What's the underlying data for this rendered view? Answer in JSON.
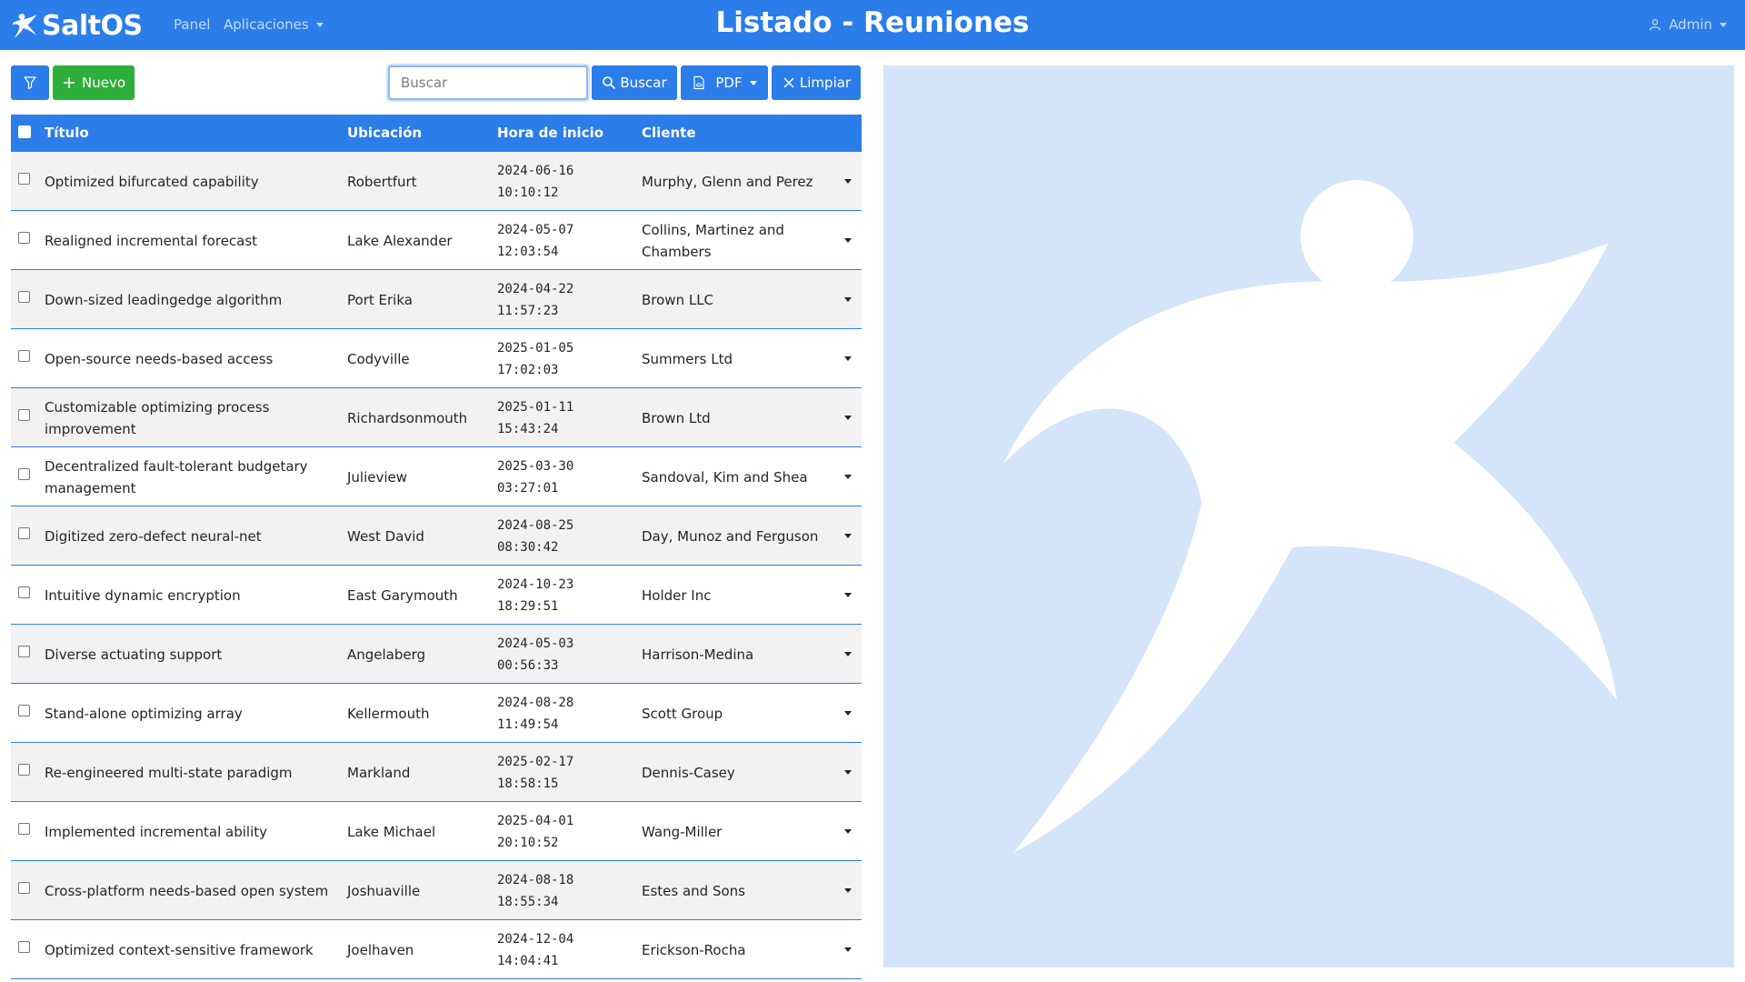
{
  "app": {
    "brand": "SaltOS"
  },
  "navbar": {
    "panel": "Panel",
    "apps": "Aplicaciones",
    "title": "Listado - Reuniones",
    "user": "Admin"
  },
  "toolbar": {
    "new_label": "Nuevo",
    "search_placeholder": "Buscar",
    "search_value": "",
    "search_label": "Buscar",
    "pdf_label": "PDF",
    "clear_label": "Limpiar"
  },
  "table": {
    "headers": [
      "Título",
      "Ubicación",
      "Hora de inicio",
      "Cliente"
    ],
    "rows": [
      {
        "title": "Optimized bifurcated capability",
        "location": "Robertfurt",
        "date": "2024-06-16",
        "time": "10:10:12",
        "client": "Murphy, Glenn and Perez"
      },
      {
        "title": "Realigned incremental forecast",
        "location": "Lake Alexander",
        "date": "2024-05-07",
        "time": "12:03:54",
        "client": "Collins, Martinez and Chambers"
      },
      {
        "title": "Down-sized leadingedge algorithm",
        "location": "Port Erika",
        "date": "2024-04-22",
        "time": "11:57:23",
        "client": "Brown LLC"
      },
      {
        "title": "Open-source needs-based access",
        "location": "Codyville",
        "date": "2025-01-05",
        "time": "17:02:03",
        "client": "Summers Ltd"
      },
      {
        "title": "Customizable optimizing process improvement",
        "location": "Richardsonmouth",
        "date": "2025-01-11",
        "time": "15:43:24",
        "client": "Brown Ltd"
      },
      {
        "title": "Decentralized fault-tolerant budgetary management",
        "location": "Julieview",
        "date": "2025-03-30",
        "time": "03:27:01",
        "client": "Sandoval, Kim and Shea"
      },
      {
        "title": "Digitized zero-defect neural-net",
        "location": "West David",
        "date": "2024-08-25",
        "time": "08:30:42",
        "client": "Day, Munoz and Ferguson"
      },
      {
        "title": "Intuitive dynamic encryption",
        "location": "East Garymouth",
        "date": "2024-10-23",
        "time": "18:29:51",
        "client": "Holder Inc"
      },
      {
        "title": "Diverse actuating support",
        "location": "Angelaberg",
        "date": "2024-05-03",
        "time": "00:56:33",
        "client": "Harrison-Medina"
      },
      {
        "title": "Stand-alone optimizing array",
        "location": "Kellermouth",
        "date": "2024-08-28",
        "time": "11:49:54",
        "client": "Scott Group"
      },
      {
        "title": "Re-engineered multi-state paradigm",
        "location": "Markland",
        "date": "2025-02-17",
        "time": "18:58:15",
        "client": "Dennis-Casey"
      },
      {
        "title": "Implemented incremental ability",
        "location": "Lake Michael",
        "date": "2025-04-01",
        "time": "20:10:52",
        "client": "Wang-Miller"
      },
      {
        "title": "Cross-platform needs-based open system",
        "location": "Joshuaville",
        "date": "2024-08-18",
        "time": "18:55:34",
        "client": "Estes and Sons"
      },
      {
        "title": "Optimized context-sensitive framework",
        "location": "Joelhaven",
        "date": "2024-12-04",
        "time": "14:04:41",
        "client": "Erickson-Rocha"
      }
    ]
  },
  "icons": {
    "brand": "saltos-star-icon",
    "user": "user-icon",
    "filter": "funnel-icon",
    "new": "plus-icon",
    "search": "search-icon",
    "pdf": "file-pdf-icon",
    "clear": "x-icon",
    "row_menu": "caret-down-icon"
  },
  "colors": {
    "primary": "#2b7de9",
    "success": "#2eae3a",
    "stripe": "#f2f2f2",
    "placeholder_bg": "#d4e5f9"
  }
}
